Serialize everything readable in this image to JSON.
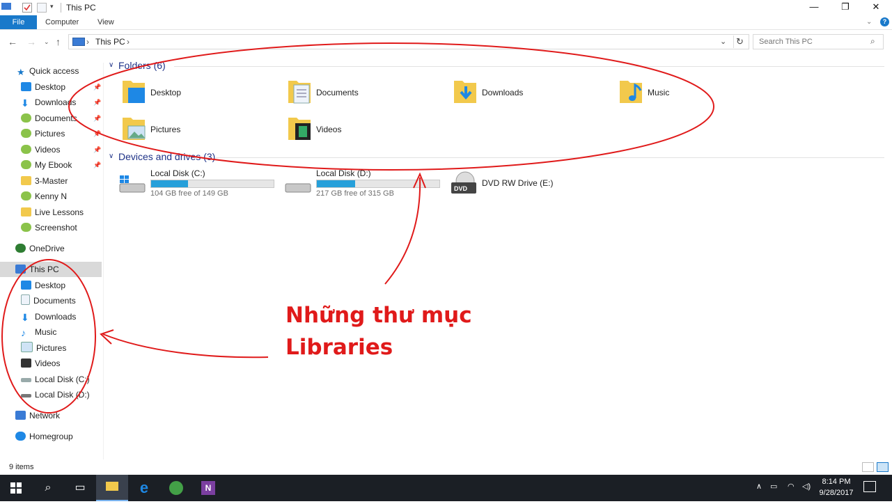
{
  "window": {
    "title": "This PC",
    "minimize": "—",
    "maximize": "❐",
    "close": "✕"
  },
  "ribbon": {
    "tabs": [
      "File",
      "Computer",
      "View"
    ]
  },
  "address": {
    "path": "This PC",
    "sep": "›"
  },
  "search": {
    "placeholder": "Search This PC"
  },
  "nav": {
    "quick_access": "Quick access",
    "quick_items": [
      "Desktop",
      "Downloads",
      "Documents",
      "Pictures",
      "Videos",
      "My Ebook",
      "3-Master",
      "Kenny N",
      "Live Lessons",
      "Screenshot"
    ],
    "onedrive": "OneDrive",
    "this_pc": "This PC",
    "pc_items": [
      "Desktop",
      "Documents",
      "Downloads",
      "Music",
      "Pictures",
      "Videos",
      "Local Disk (C:)",
      "Local Disk (D:)"
    ],
    "network": "Network",
    "homegroup": "Homegroup"
  },
  "content": {
    "folders_header": "Folders (6)",
    "folders": [
      "Desktop",
      "Documents",
      "Downloads",
      "Music",
      "Pictures",
      "Videos"
    ],
    "drives_header": "Devices and drives (3)",
    "drives": [
      {
        "name": "Local Disk (C:)",
        "free": "104 GB free of 149 GB",
        "used_fraction": 0.3
      },
      {
        "name": "Local Disk (D:)",
        "free": "217 GB free of 315 GB",
        "used_fraction": 0.31
      },
      {
        "name": "DVD RW Drive (E:)"
      }
    ]
  },
  "status": {
    "items": "9 items"
  },
  "annotation": {
    "line1": "Những thư mục",
    "line2": "Libraries"
  },
  "taskbar": {
    "time": "8:14 PM",
    "date": "9/28/2017"
  },
  "colors": {
    "accent": "#1979ca",
    "annotation": "#e01a1a",
    "drive_bar": "#26a0da",
    "folder": "#f2c94c"
  }
}
